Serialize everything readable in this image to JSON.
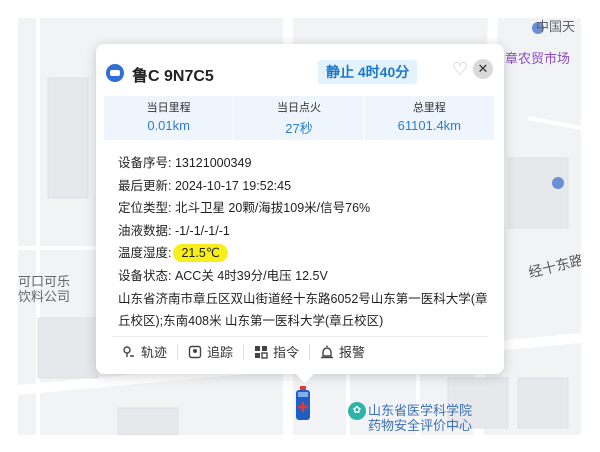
{
  "map": {
    "labels": {
      "top_right": "中国天",
      "market": "章农贸市场",
      "coke": "可口可乐",
      "beverage": "饮料公司",
      "road": "经十东路",
      "school_line1": "山东省医学科学院",
      "school_line2": "药物安全评价中心"
    }
  },
  "popup": {
    "plate": "鲁C 9N7C5",
    "status": "静止 4时40分",
    "stats": [
      {
        "label": "当日里程",
        "value": "0.01km"
      },
      {
        "label": "当日点火",
        "value": "27秒"
      },
      {
        "label": "总里程",
        "value": "61101.4km"
      }
    ],
    "info": {
      "serial": "设备序号: 13121000349",
      "updated": "最后更新: 2024-10-17 19:52:45",
      "location_type": "定位类型: 北斗卫星 20颗/海拔109米/信号76%",
      "fuel": "油液数据: -1/-1/-1/-1",
      "temp_label": "温度湿度:",
      "temp_value": "21.5℃",
      "device_status": "设备状态: ACC关 4时39分/电压 12.5V",
      "address": "山东省济南市章丘区双山街道经十东路6052号山东第一医科大学(章丘校区);东南408米 山东第一医科大学(章丘校区)"
    },
    "actions": [
      {
        "label": "轨迹",
        "icon": "track-icon"
      },
      {
        "label": "追踪",
        "icon": "follow-icon"
      },
      {
        "label": "指令",
        "icon": "command-icon"
      },
      {
        "label": "报警",
        "icon": "alarm-icon"
      }
    ]
  },
  "colors": {
    "accent": "#2b7cd3",
    "status_bg": "#e4f2fd",
    "temp_highlight": "#f8ee1c"
  }
}
